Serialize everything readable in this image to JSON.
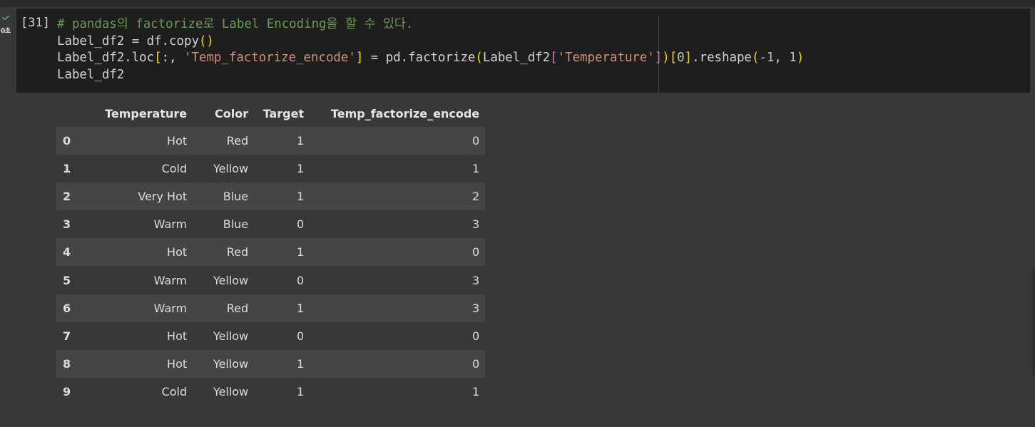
{
  "cell": {
    "execution_count": "[31]",
    "run_time": "0초",
    "code": [
      [
        {
          "t": "# pandas의 factorize로 Label Encoding을 할 수 있다.",
          "c": "tok-comment"
        }
      ],
      [
        {
          "t": "Label_df2 = df.copy"
        },
        {
          "t": "()",
          "c": "tok-b1"
        }
      ],
      [
        {
          "t": "Label_df2.loc"
        },
        {
          "t": "[",
          "c": "tok-b1"
        },
        {
          "t": ":, "
        },
        {
          "t": "'Temp_factorize_encode'",
          "c": "tok-string"
        },
        {
          "t": "]",
          "c": "tok-b1"
        },
        {
          "t": " = pd.factorize"
        },
        {
          "t": "(",
          "c": "tok-b1"
        },
        {
          "t": "Label_df2"
        },
        {
          "t": "[",
          "c": "tok-b2"
        },
        {
          "t": "'Temperature'",
          "c": "tok-string"
        },
        {
          "t": "]",
          "c": "tok-b2"
        },
        {
          "t": ")",
          "c": "tok-b1"
        },
        {
          "t": "[",
          "c": "tok-b1"
        },
        {
          "t": "0",
          "c": "tok-num"
        },
        {
          "t": "]",
          "c": "tok-b1"
        },
        {
          "t": ".reshape"
        },
        {
          "t": "(",
          "c": "tok-b1"
        },
        {
          "t": "-1",
          "c": "tok-num"
        },
        {
          "t": ", "
        },
        {
          "t": "1",
          "c": "tok-num"
        },
        {
          "t": ")",
          "c": "tok-b1"
        }
      ],
      [
        {
          "t": "Label_df2"
        }
      ]
    ]
  },
  "output": {
    "columns": [
      "",
      "Temperature",
      "Color",
      "Target",
      "Temp_factorize_encode"
    ],
    "rows": [
      [
        "0",
        "Hot",
        "Red",
        "1",
        "0"
      ],
      [
        "1",
        "Cold",
        "Yellow",
        "1",
        "1"
      ],
      [
        "2",
        "Very Hot",
        "Blue",
        "1",
        "2"
      ],
      [
        "3",
        "Warm",
        "Blue",
        "0",
        "3"
      ],
      [
        "4",
        "Hot",
        "Red",
        "1",
        "0"
      ],
      [
        "5",
        "Warm",
        "Yellow",
        "0",
        "3"
      ],
      [
        "6",
        "Warm",
        "Red",
        "1",
        "3"
      ],
      [
        "7",
        "Hot",
        "Yellow",
        "0",
        "0"
      ],
      [
        "8",
        "Hot",
        "Yellow",
        "1",
        "0"
      ],
      [
        "9",
        "Cold",
        "Yellow",
        "1",
        "1"
      ]
    ]
  },
  "colors": {
    "background": "#383838",
    "editor": "#1e1e1e",
    "success_check": "#4caf50",
    "comment": "#6a9955",
    "string": "#ce9178",
    "number": "#b5cea8"
  },
  "icons": {
    "run_status": "check-icon"
  }
}
